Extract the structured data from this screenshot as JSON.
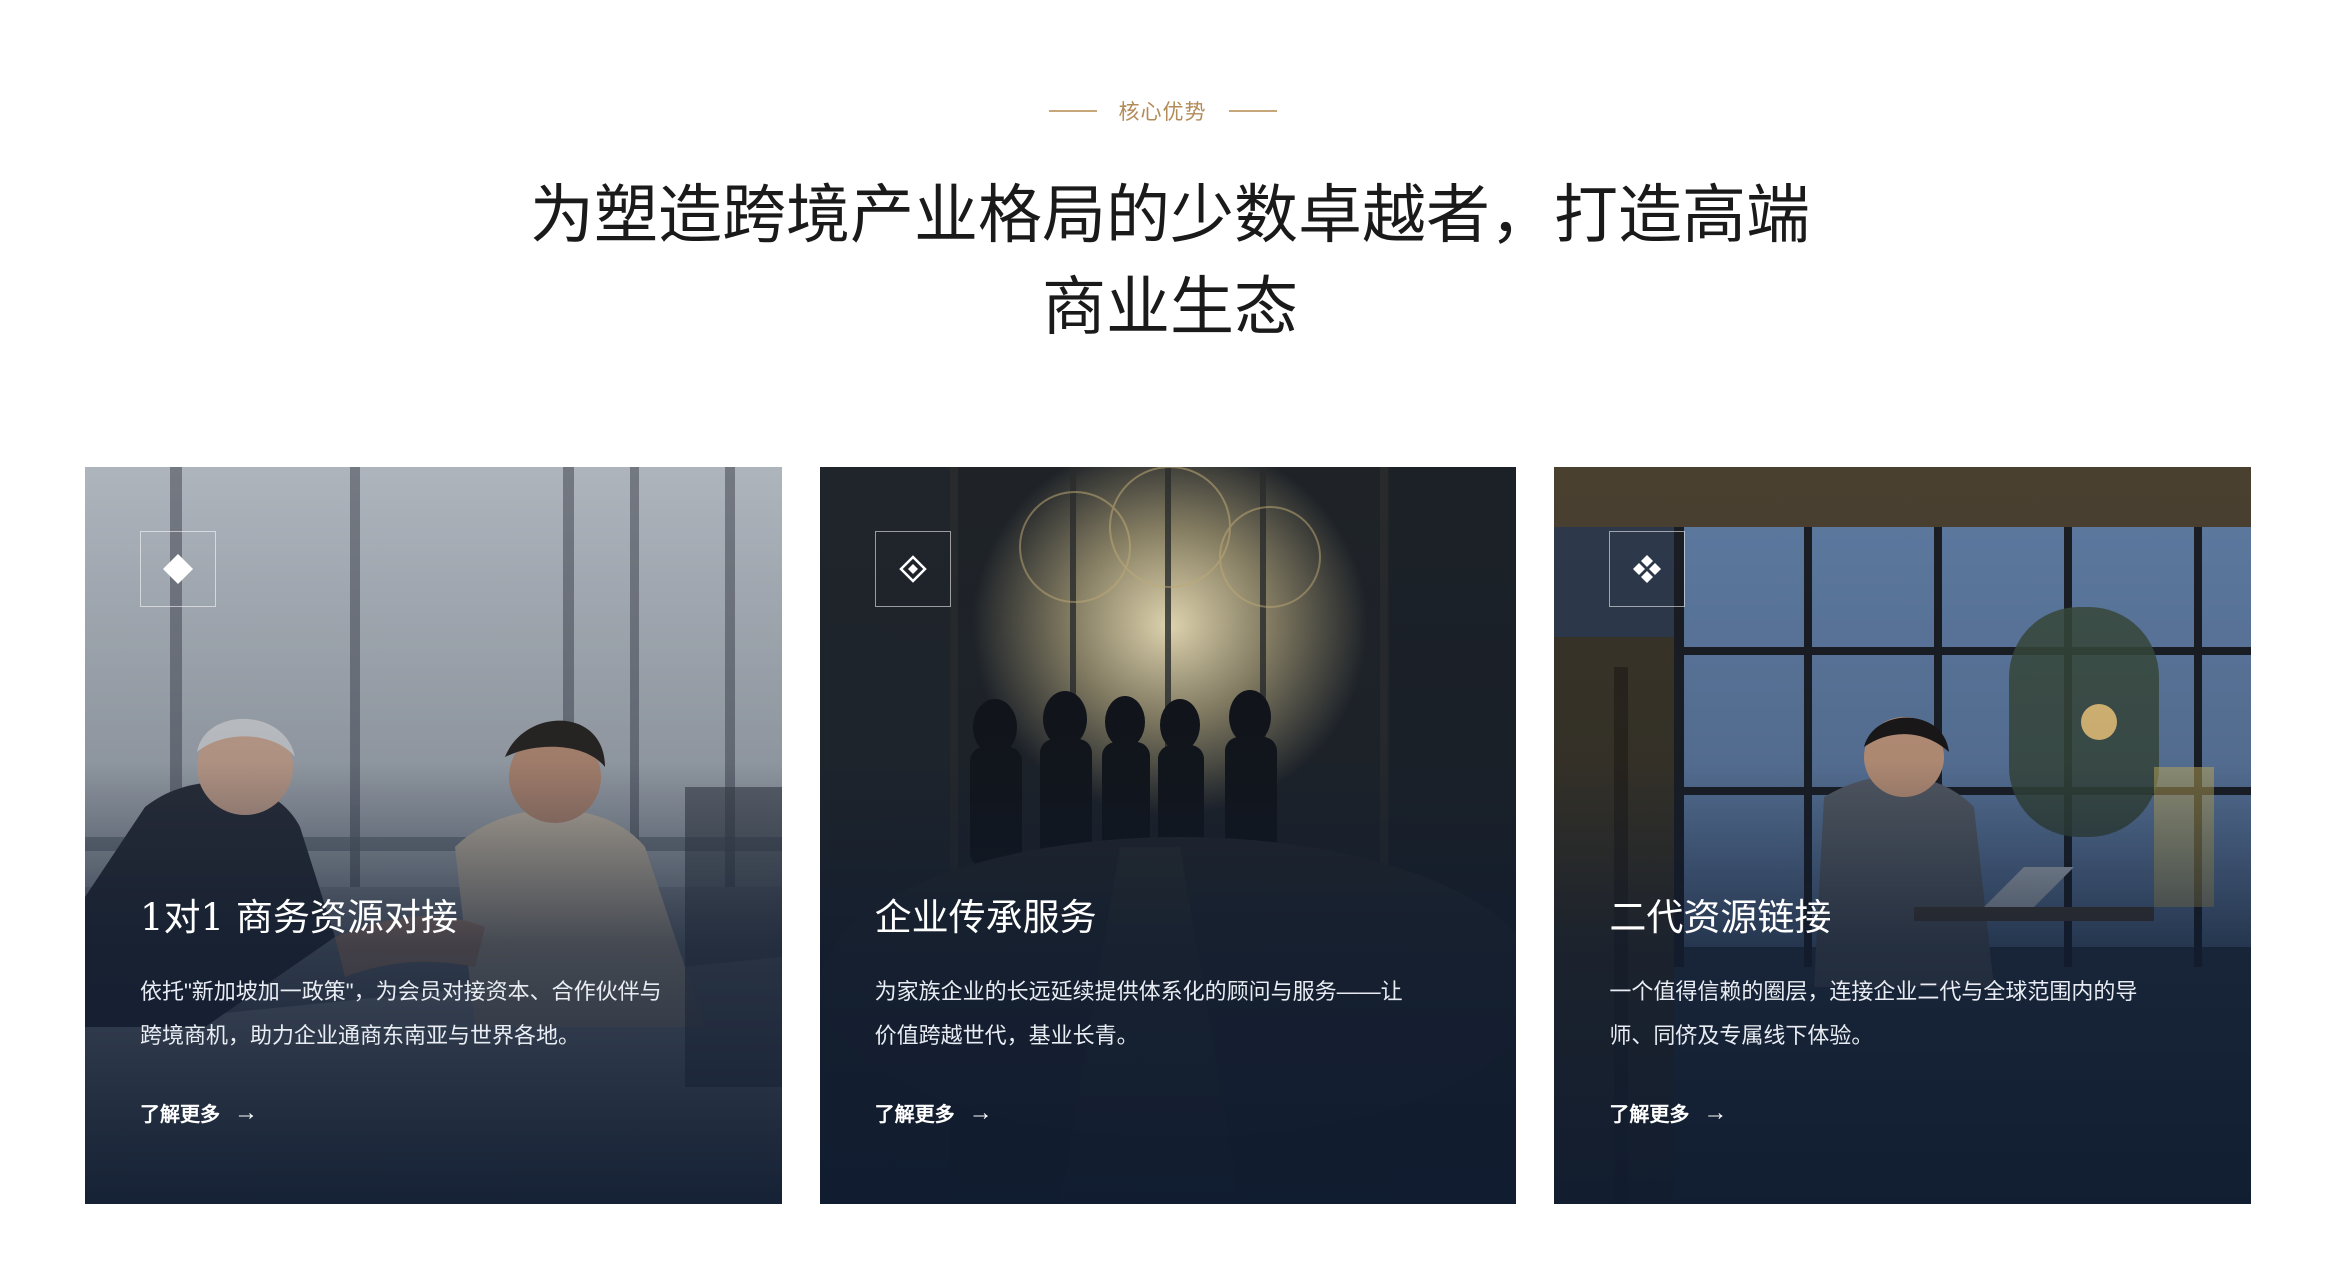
{
  "eyebrow": "核心优势",
  "headline": {
    "line1": "为塑造跨境产业格局的少数卓越者，打造高端",
    "line2": "商业生态"
  },
  "cards": [
    {
      "icon": "diamond-icon",
      "title": "1对1 商务资源对接",
      "desc_line1": "依托\"新加坡加一政策\"，为会员对接资本、合作伙伴与",
      "desc_line2": "跨境商机，助力企业通商东南亚与世界各地。",
      "link": "了解更多",
      "link_arrow": "→"
    },
    {
      "icon": "nested-diamond-icon",
      "title": "企业传承服务",
      "desc_line1": "为家族企业的长远延续提供体系化的顾问与服务——让",
      "desc_line2": "价值跨越世代，基业长青。",
      "link": "了解更多",
      "link_arrow": "→"
    },
    {
      "icon": "four-diamonds-icon",
      "title": "二代资源链接",
      "desc_line1": "一个值得信赖的圈层，连接企业二代与全球范围内的导",
      "desc_line2": "师、同侪及专属线下体验。",
      "link": "了解更多",
      "link_arrow": "→"
    }
  ],
  "colors": {
    "accent_gold": "#b38b59",
    "card_overlay": "#101c30"
  }
}
